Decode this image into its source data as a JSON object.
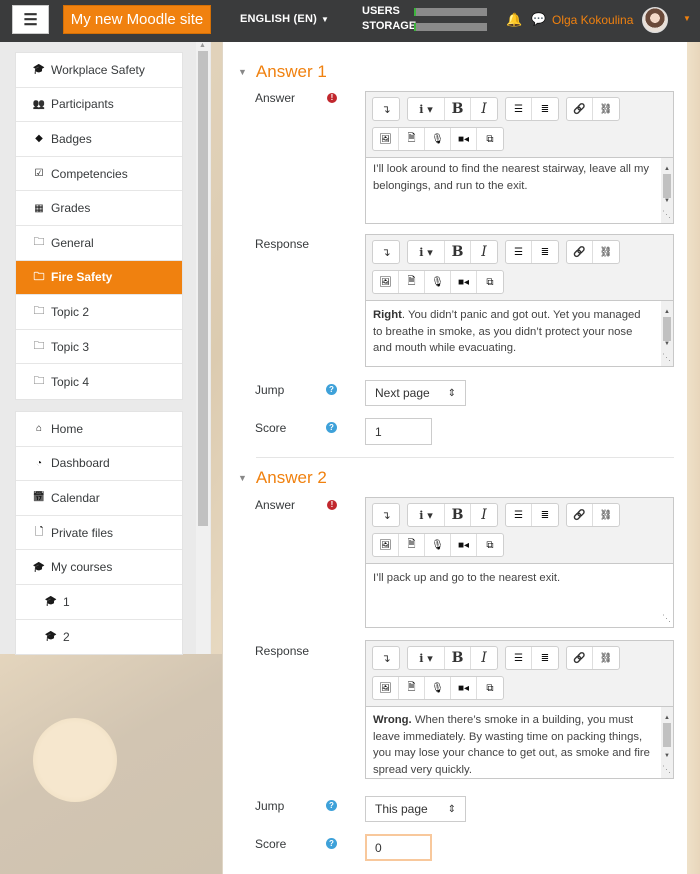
{
  "navbar": {
    "menu_icon": "hamburger-icon",
    "site_name": "My new Moodle site",
    "language": "ENGLISH (EN)",
    "usage": [
      {
        "label": "USERS"
      },
      {
        "label": "STORAGE"
      }
    ],
    "user_name": "Olga Kokoulina",
    "bell_icon": "bell-icon",
    "chat_icon": "chat-icon",
    "accent": "#f0810f"
  },
  "drawer": {
    "course_nav": [
      {
        "label": "Workplace Safety",
        "icon": "graduation-cap-icon"
      },
      {
        "label": "Participants",
        "icon": "users-icon"
      },
      {
        "label": "Badges",
        "icon": "shield-icon"
      },
      {
        "label": "Competencies",
        "icon": "check-square-icon"
      },
      {
        "label": "Grades",
        "icon": "table-icon"
      },
      {
        "label": "General",
        "icon": "folder-icon"
      },
      {
        "label": "Fire Safety",
        "icon": "folder-icon",
        "active": true
      },
      {
        "label": "Topic 2",
        "icon": "folder-icon"
      },
      {
        "label": "Topic 3",
        "icon": "folder-icon"
      },
      {
        "label": "Topic 4",
        "icon": "folder-icon"
      }
    ],
    "site_nav": [
      {
        "label": "Home",
        "icon": "home-icon"
      },
      {
        "label": "Dashboard",
        "icon": "dashboard-icon"
      },
      {
        "label": "Calendar",
        "icon": "calendar-icon"
      },
      {
        "label": "Private files",
        "icon": "file-icon"
      },
      {
        "label": "My courses",
        "icon": "graduation-cap-icon"
      },
      {
        "label": "1",
        "icon": "graduation-cap-icon",
        "sub": true
      },
      {
        "label": "2",
        "icon": "graduation-cap-icon",
        "sub": true
      }
    ]
  },
  "answers": [
    {
      "title": "Answer 1",
      "answer_label": "Answer",
      "answer_text": "I’ll look around to find the nearest stairway, leave all my belongings, and run to the exit.",
      "response_label": "Response",
      "response_bold": "Right",
      "response_text": ". You didn’t panic and got out. Yet you managed to breathe in smoke, as you didn’t protect your nose and mouth while evacuating.",
      "jump_label": "Jump",
      "jump_value": "Next page",
      "score_label": "Score",
      "score_value": "1"
    },
    {
      "title": "Answer 2",
      "answer_label": "Answer",
      "answer_text": "I’ll pack up and go to the nearest exit.",
      "response_label": "Response",
      "response_bold": "Wrong.",
      "response_text": " When there’s smoke in a building, you must leave immediately. By wasting time on packing things, you may lose your chance to get out, as smoke and fire spread very quickly.",
      "jump_label": "Jump",
      "jump_value": "This page",
      "score_label": "Score",
      "score_value": "0"
    }
  ],
  "toolbar": {
    "row1": [
      [
        "collapse-icon"
      ],
      [
        "paragraph-styles-icon",
        "bold-icon",
        "italic-icon"
      ],
      [
        "unordered-list-icon",
        "ordered-list-icon"
      ],
      [
        "link-icon",
        "unlink-icon"
      ]
    ],
    "row2": [
      [
        "image-icon",
        "media-icon",
        "record-audio-icon",
        "record-video-icon",
        "manage-files-icon"
      ]
    ]
  }
}
